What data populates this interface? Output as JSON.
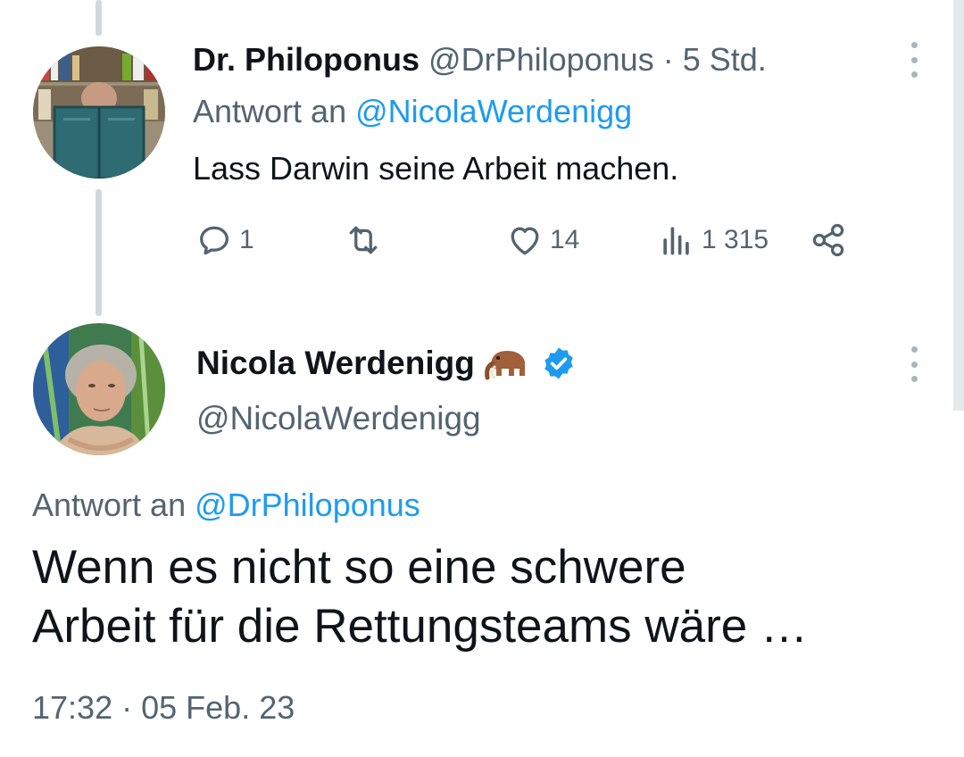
{
  "tweet1": {
    "name": "Dr. Philoponus",
    "handle": "@DrPhiloponus",
    "separator": "·",
    "time": "5 Std.",
    "reply_prefix": "Antwort an",
    "reply_mention": "@NicolaWerdenigg",
    "text": "Lass Darwin seine Arbeit machen.",
    "stats": {
      "replies": "1",
      "retweets": "",
      "likes": "14",
      "views": "1 315"
    }
  },
  "tweet2": {
    "name": "Nicola Werdenigg",
    "name_emoji": "mammoth",
    "verified": true,
    "handle": "@NicolaWerdenigg",
    "reply_prefix": "Antwort an",
    "reply_mention": "@DrPhiloponus",
    "text_lines": [
      "Wenn es nicht so eine schwere",
      "Arbeit für die Rettungsteams wäre …"
    ],
    "time": "17:32",
    "separator": "·",
    "date": "05 Feb. 23"
  },
  "icons": {
    "reply": "reply-icon",
    "retweet": "retweet-icon",
    "like": "heart-icon",
    "views": "views-icon",
    "share": "share-icon",
    "more": "more-vertical-icon",
    "verified": "verified-badge-icon"
  },
  "colors": {
    "text": "#0f1419",
    "secondary": "#536471",
    "accent": "#1d9bf0",
    "thread_line": "#cfd9de"
  }
}
